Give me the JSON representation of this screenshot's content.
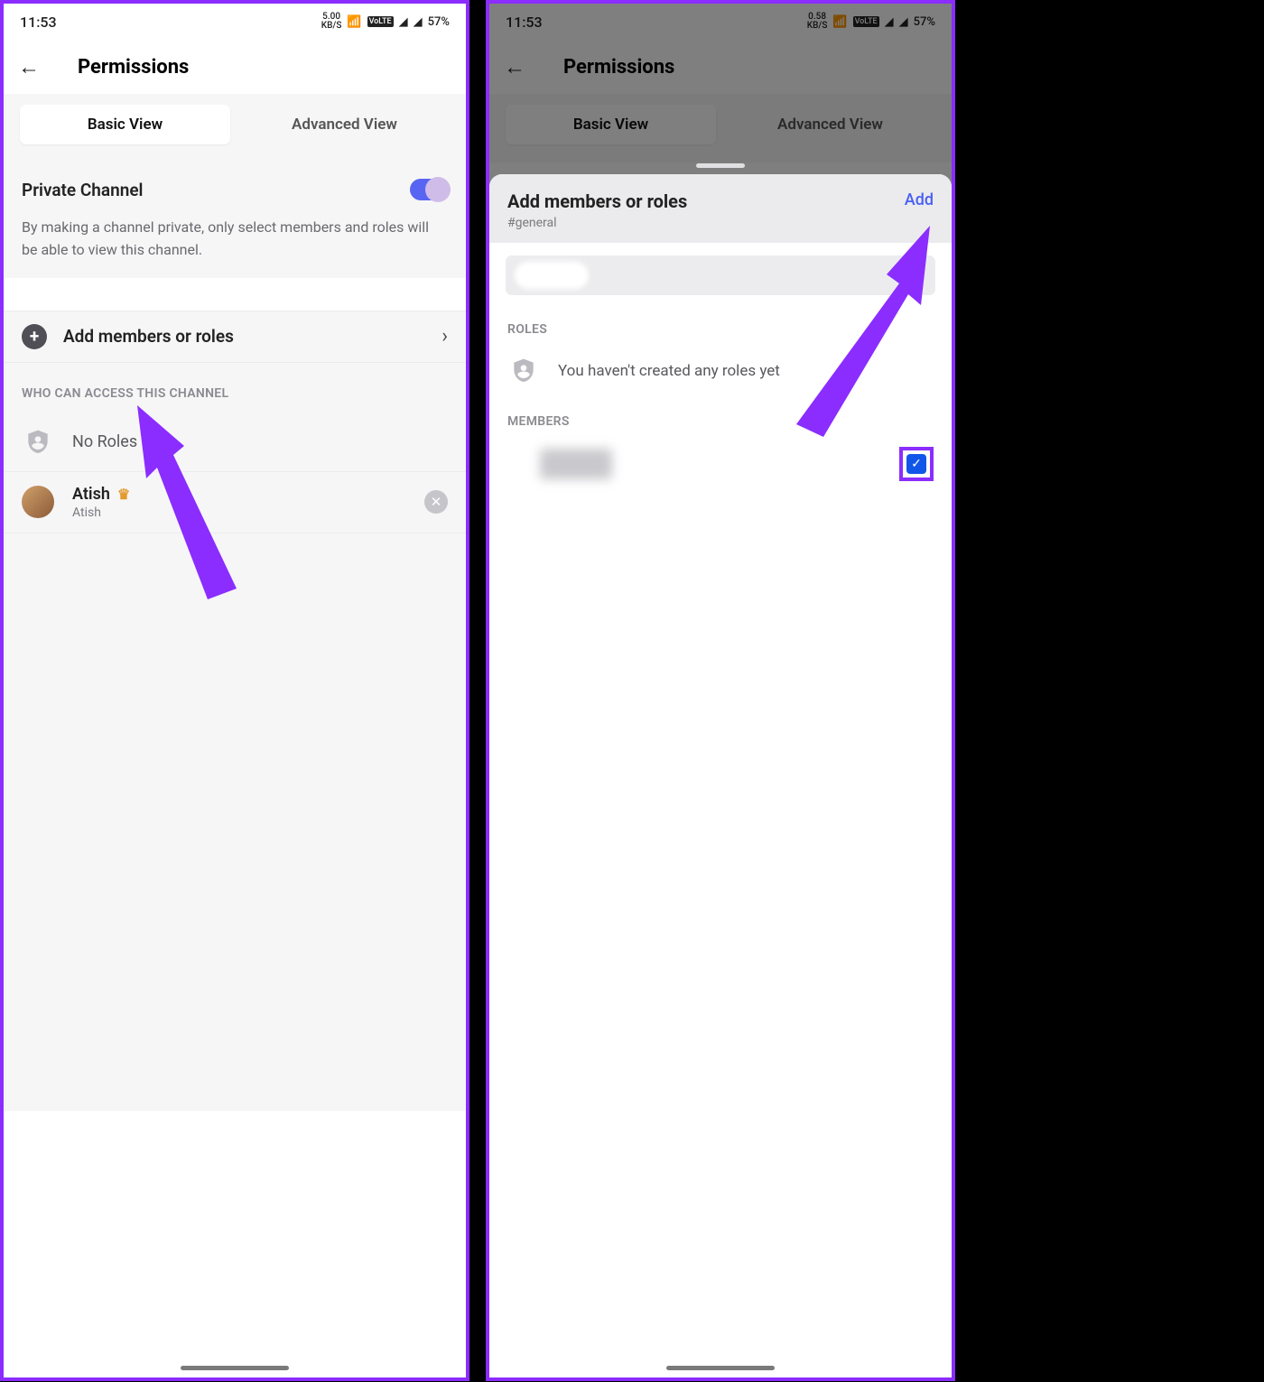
{
  "statusbar": {
    "time": "11:53",
    "kbps1": "5.00",
    "kbps2": "0.58",
    "kbps_unit": "KB/S",
    "battery": "57%"
  },
  "header": {
    "title": "Permissions"
  },
  "tabs": {
    "basic": "Basic View",
    "advanced": "Advanced View"
  },
  "private": {
    "label": "Private Channel",
    "desc": "By making a channel private, only select members and roles will be able to view this channel."
  },
  "addrow": "Add members or roles",
  "whocan": "WHO CAN ACCESS THIS CHANNEL",
  "noroles": "No Roles",
  "member": {
    "display": "Atish",
    "username": "Atish"
  },
  "sheet": {
    "title": "Add members or roles",
    "channel": "#general",
    "add": "Add",
    "roles_label": "ROLES",
    "roles_empty": "You haven't created any roles yet",
    "members_label": "MEMBERS"
  }
}
